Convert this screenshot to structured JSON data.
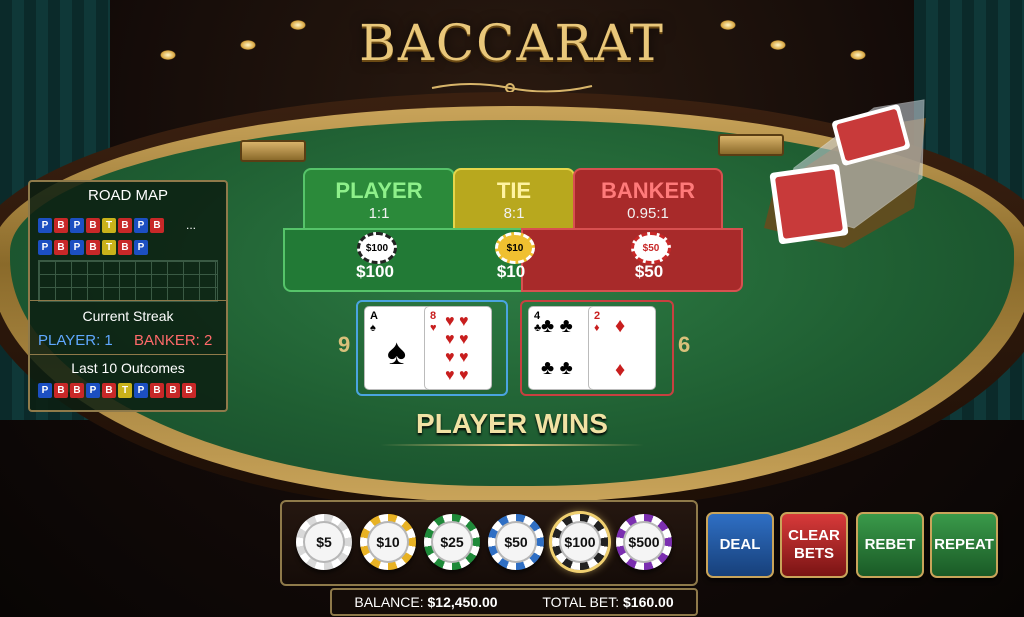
{
  "title": "BACCARAT",
  "bets": {
    "player": {
      "name": "PLAYER",
      "odds": "1:1",
      "chip": "$100",
      "amount": "$100"
    },
    "tie": {
      "name": "TIE",
      "odds": "8:1",
      "chip": "$10",
      "amount": "$10"
    },
    "banker": {
      "name": "BANKER",
      "odds": "0.95:1",
      "chip": "$50",
      "amount": "$50"
    }
  },
  "road_map": {
    "title": "ROAD MAP",
    "row1": [
      "P",
      "B",
      "P",
      "B",
      "T",
      "B",
      "P",
      "B"
    ],
    "row1_more": "...",
    "row2": [
      "P",
      "B",
      "P",
      "B",
      "T",
      "B",
      "P"
    ],
    "streak_title": "Current Streak",
    "player_streak": "PLAYER: 1",
    "banker_streak": "BANKER: 2",
    "last10_title": "Last 10 Outcomes",
    "last10": [
      "P",
      "B",
      "B",
      "P",
      "B",
      "T",
      "P",
      "B",
      "B",
      "B"
    ]
  },
  "hands": {
    "player": {
      "score": "9",
      "cards": [
        {
          "rank": "A",
          "suit": "♠"
        },
        {
          "rank": "8",
          "suit": "♥"
        }
      ]
    },
    "banker": {
      "score": "6",
      "cards": [
        {
          "rank": "4",
          "suit": "♣"
        },
        {
          "rank": "2",
          "suit": "♦"
        }
      ]
    }
  },
  "result": "PLAYER WINS",
  "chips": [
    {
      "label": "$5",
      "color": "#d9d9d9"
    },
    {
      "label": "$10",
      "color": "#e8b224"
    },
    {
      "label": "$25",
      "color": "#1f8a3a"
    },
    {
      "label": "$50",
      "color": "#2f6fc4"
    },
    {
      "label": "$100",
      "color": "#222222"
    },
    {
      "label": "$500",
      "color": "#7b2fb0"
    }
  ],
  "buttons": {
    "deal": "DEAL",
    "clear_bets": "CLEAR BETS",
    "rebet": "REBET",
    "repeat": "REPEAT"
  },
  "status": {
    "balance_label": "BALANCE:",
    "balance": "$12,450.00",
    "total_bet_label": "TOTAL BET:",
    "total_bet": "$160.00"
  },
  "colors": {
    "player": "#1f8a3a",
    "tie": "#c9b21a",
    "banker": "#b82a2a",
    "gold": "#c9a45a"
  }
}
